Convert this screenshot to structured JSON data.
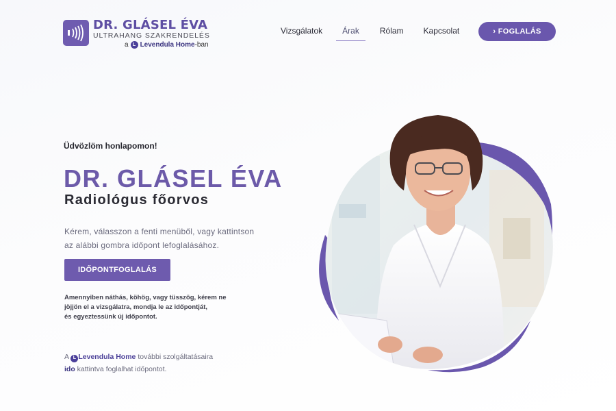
{
  "header": {
    "logo": {
      "name": "DR. GLÁSEL ÉVA",
      "subtitle": "ULTRAHANG SZAKRENDELÉS",
      "tagline_prefix": "a",
      "tagline_brand": "Levendula Home",
      "tagline_suffix": "-ban",
      "icon": "ultrasound-waves-icon"
    },
    "nav": [
      {
        "label": "Vizsgálatok",
        "active": false
      },
      {
        "label": "Árak",
        "active": true
      },
      {
        "label": "Rólam",
        "active": false
      },
      {
        "label": "Kapcsolat",
        "active": false
      }
    ],
    "book_button": "› FOGLALÁS"
  },
  "hero": {
    "welcome": "Üdvözlöm honlapomon!",
    "name": "DR. GLÁSEL ÉVA",
    "title": "Radiológus főorvos",
    "intro_line1": "Kérem, válasszon a fenti menüből, vagy kattintson",
    "intro_line2": "az alábbi gombra időpont lefoglalásához.",
    "cta_button": "IDŐPONTFOGLALÁS",
    "notice_line1": "Amennyiben náthás, köhög, vagy tüsszög, kérem ne",
    "notice_line2": "jöjjön el a vizsgálatra, mondja le az időpontját,",
    "notice_line3": "és egyeztessünk új időpontot.",
    "lv_prefix": "A",
    "lv_brand": "Levendula Home",
    "lv_rest": "további szolgáltatásaira",
    "lv_link": "ido",
    "lv_rest2": "kattintva foglalhat időpontot."
  },
  "colors": {
    "accent": "#6a57ad",
    "accent_dark": "#4b3f9a",
    "text": "#2a2a33",
    "muted": "#6b6b7e"
  }
}
